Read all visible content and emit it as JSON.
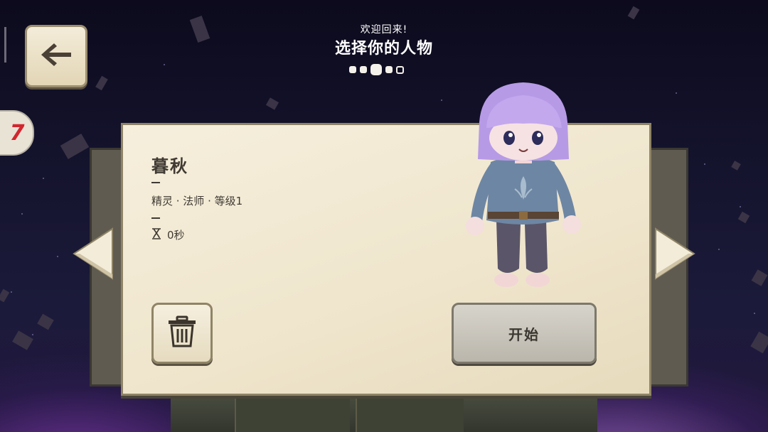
{
  "header": {
    "subtitle": "欢迎回来!",
    "title": "选择你的人物",
    "page_dots": {
      "total": 5,
      "active_index": 2
    }
  },
  "navigation": {
    "back_icon": "arrow-left-icon",
    "side_tab_logo_text": "7"
  },
  "character": {
    "name": "暮秋",
    "info_line": "精灵 · 法师 · 等级1",
    "divider": "—",
    "playtime_icon": "hourglass-icon",
    "playtime": "0秒"
  },
  "actions": {
    "delete_icon": "trash-icon",
    "start_label": "开始",
    "prev_icon": "chevron-left-icon",
    "next_icon": "chevron-right-icon"
  },
  "colors": {
    "panel": "#f6efdd",
    "panel_border": "#8f8466",
    "text": "#3f3a33",
    "hair": "#b79ae6",
    "shirt": "#6d86a3"
  }
}
